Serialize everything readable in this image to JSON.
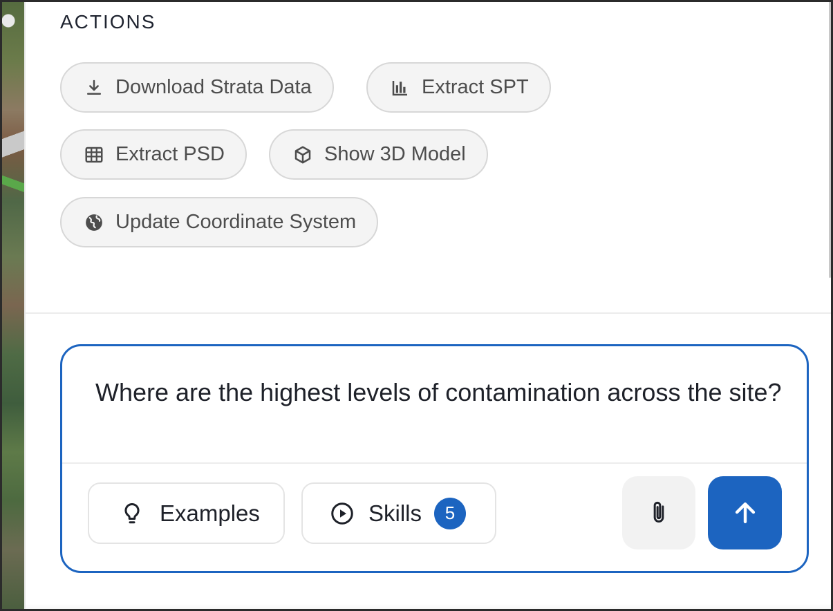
{
  "actions": {
    "title": "ACTIONS",
    "buttons": [
      {
        "label": "Download Strata Data",
        "icon": "download-icon"
      },
      {
        "label": "Extract SPT",
        "icon": "bar-chart-icon"
      },
      {
        "label": "Extract PSD",
        "icon": "table-icon"
      },
      {
        "label": "Show 3D Model",
        "icon": "cube-icon"
      },
      {
        "label": "Update Coordinate System",
        "icon": "globe-icon"
      }
    ]
  },
  "composer": {
    "prompt": "Where are the highest levels of contamination across the site?",
    "examples_label": "Examples",
    "examples_icon": "lightbulb-icon",
    "skills_label": "Skills",
    "skills_icon": "play-circle-icon",
    "skills_count": "5",
    "attach_icon": "paperclip-icon",
    "send_icon": "arrow-up-icon"
  },
  "colors": {
    "accent": "#1c64c0",
    "chip_bg": "#f4f4f4",
    "chip_border": "#d7d7d7",
    "text_dark": "#1e2129",
    "chip_text": "#4d4d4d"
  }
}
